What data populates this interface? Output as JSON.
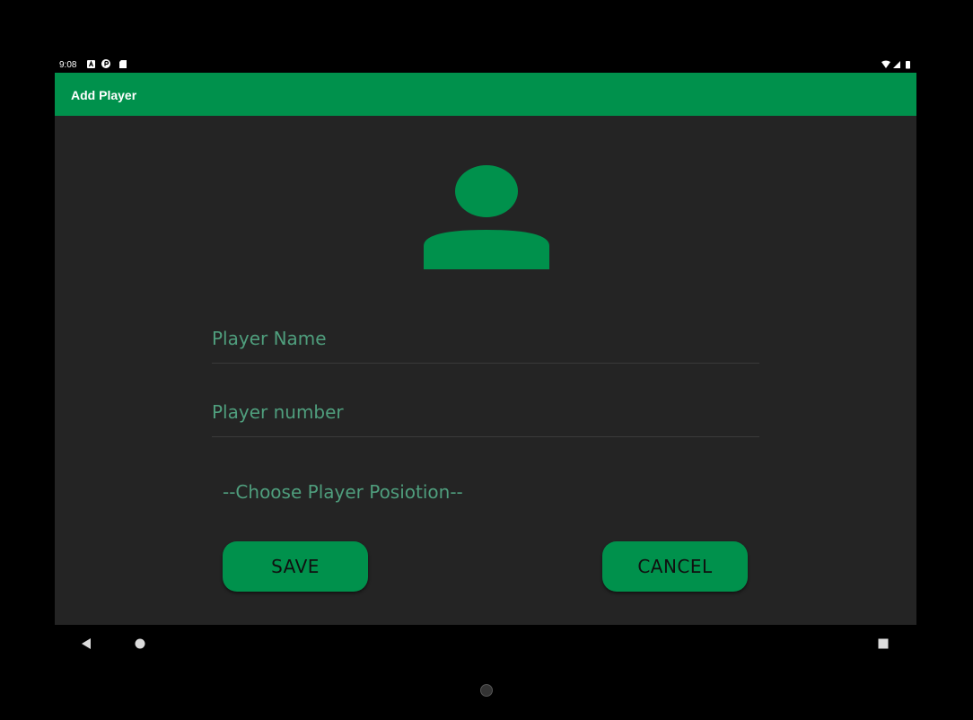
{
  "status_bar": {
    "time": "9:08",
    "left_icons": [
      "notification-a-icon",
      "notification-p-icon",
      "sd-card-icon"
    ],
    "right_icons": [
      "wifi-icon",
      "signal-icon",
      "battery-icon"
    ]
  },
  "app_bar": {
    "title": "Add Player"
  },
  "form": {
    "avatar_icon": "person-icon",
    "player_name_placeholder": "Player Name",
    "player_name_value": "",
    "player_number_placeholder": "Player number",
    "player_number_value": "",
    "position_spinner_text": "--Choose Player Posiotion--"
  },
  "buttons": {
    "save_label": "SAVE",
    "cancel_label": "CANCEL"
  },
  "nav_bar": {
    "icons": [
      "back-icon",
      "home-icon",
      "recents-icon"
    ]
  },
  "colors": {
    "accent": "#00914c",
    "hint": "#4f9e7d",
    "background": "#242424"
  }
}
